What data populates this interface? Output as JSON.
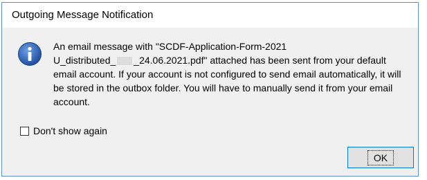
{
  "window": {
    "title": "Outgoing Message Notification"
  },
  "dialog": {
    "icon": "info-icon",
    "message_lines": [
      "An email message with \"SCDF-Application-Form-2021",
      "U_distributed_",
      "_24.06.2021.pdf\" attached has been sent from your default",
      "email account. If your account is not configured to send email automatically, it will",
      "be stored in the outbox folder. You will have to manually send it from your email",
      "account."
    ],
    "dont_show_again": {
      "label": "Don't show again",
      "checked": false
    },
    "ok_label": "OK"
  },
  "colors": {
    "accent": "#0078d7",
    "info_icon": "#2a5ca8"
  }
}
